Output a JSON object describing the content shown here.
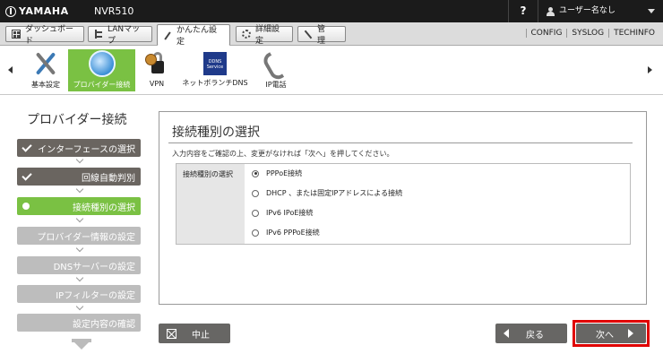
{
  "header": {
    "brand": "YAMAHA",
    "model": "NVR510",
    "help_label": "?",
    "user_label": "ユーザー名なし"
  },
  "tabs": [
    {
      "label": "ダッシュボード",
      "icon": "dashboard-icon"
    },
    {
      "label": "LANマップ",
      "icon": "lan-map-icon"
    },
    {
      "label": "かんたん設定",
      "icon": "wizard-icon",
      "active": true
    },
    {
      "label": "詳細設定",
      "icon": "gear-icon"
    },
    {
      "label": "管　理",
      "icon": "wrench-icon"
    }
  ],
  "toplinks": [
    "CONFIG",
    "SYSLOG",
    "TECHINFO"
  ],
  "menu": [
    {
      "label": "基本設定",
      "icon": "tools-icon"
    },
    {
      "label": "プロバイダー接続",
      "icon": "globe-icon",
      "active": true
    },
    {
      "label": "VPN",
      "icon": "vpn-lock-icon"
    },
    {
      "label": "ネットボランチDNS",
      "icon": "ddns-icon",
      "icon_text": [
        "DDNS",
        "Service"
      ]
    },
    {
      "label": "IP電話",
      "icon": "phone-icon"
    }
  ],
  "sidebar": {
    "title": "プロバイダー接続",
    "steps": [
      {
        "label": "インターフェースの選択",
        "state": "done"
      },
      {
        "label": "回線自動判別",
        "state": "done"
      },
      {
        "label": "接続種別の選択",
        "state": "current"
      },
      {
        "label": "プロバイダー情報の設定",
        "state": "todo"
      },
      {
        "label": "DNSサーバーの設定",
        "state": "todo"
      },
      {
        "label": "IPフィルターの設定",
        "state": "todo"
      },
      {
        "label": "設定内容の確認",
        "state": "todo"
      }
    ]
  },
  "main": {
    "title": "接続種別の選択",
    "description": "入力内容をご確認の上、変更がなければ「次へ」を押してください。",
    "field_label": "接続種別の選択",
    "options": [
      {
        "label": "PPPoE接続",
        "selected": true
      },
      {
        "label": "DHCP 、または固定IPアドレスによる接続",
        "selected": false
      },
      {
        "label": "IPv6 IPoE接続",
        "selected": false
      },
      {
        "label": "IPv6 PPPoE接続",
        "selected": false
      }
    ]
  },
  "buttons": {
    "cancel": "中止",
    "back": "戻る",
    "next": "次へ"
  },
  "colors": {
    "accent_green": "#7ac143",
    "highlight_red": "#e00000",
    "topbar": "#1b1b1b"
  }
}
